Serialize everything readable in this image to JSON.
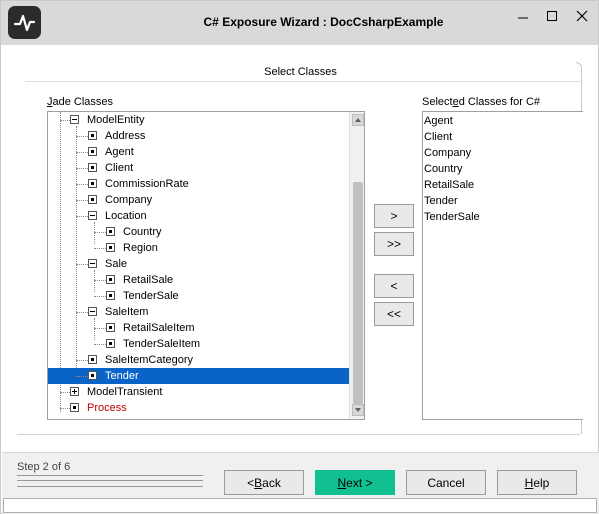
{
  "window": {
    "title": "C# Exposure Wizard : DocCsharpExample"
  },
  "section_title": "Select Classes",
  "left_list": {
    "label_prefix": "",
    "label_u": "J",
    "label_rest": "ade Classes",
    "rows": [
      {
        "label": "ModelEntity",
        "expander": "minus"
      },
      {
        "label": "Address",
        "expander": "leaf"
      },
      {
        "label": "Agent",
        "expander": "leaf"
      },
      {
        "label": "Client",
        "expander": "leaf"
      },
      {
        "label": "CommissionRate",
        "expander": "leaf"
      },
      {
        "label": "Company",
        "expander": "leaf"
      },
      {
        "label": "Location",
        "expander": "minus"
      },
      {
        "label": "Country",
        "expander": "leaf"
      },
      {
        "label": "Region",
        "expander": "leaf"
      },
      {
        "label": "Sale",
        "expander": "minus"
      },
      {
        "label": "RetailSale",
        "expander": "leaf"
      },
      {
        "label": "TenderSale",
        "expander": "leaf"
      },
      {
        "label": "SaleItem",
        "expander": "minus"
      },
      {
        "label": "RetailSaleItem",
        "expander": "leaf"
      },
      {
        "label": "TenderSaleItem",
        "expander": "leaf"
      },
      {
        "label": "SaleItemCategory",
        "expander": "leaf"
      },
      {
        "label": "Tender",
        "expander": "leaf",
        "selected": true
      },
      {
        "label": "ModelTransient",
        "expander": "plus"
      },
      {
        "label": "Process",
        "expander": "leaf",
        "color": "#c00000"
      }
    ]
  },
  "move_buttons": {
    "add": ">",
    "add_all": ">>",
    "remove": "<",
    "remove_all": "<<"
  },
  "right_list": {
    "label_a": "Select",
    "label_u": "e",
    "label_b": "d Classes for C#",
    "items": [
      "Agent",
      "Client",
      "Company",
      "Country",
      "RetailSale",
      "Tender",
      "TenderSale"
    ]
  },
  "footer": {
    "step": "Step 2 of 6",
    "back_prefix": "< ",
    "back_u": "B",
    "back_rest": "ack",
    "next_u": "N",
    "next_rest": "ext >",
    "cancel": "Cancel",
    "help_u": "H",
    "help_rest": "elp"
  },
  "colors": {
    "selection": "#0a64c8",
    "next_button": "#10c090",
    "red_text": "#c00000"
  }
}
